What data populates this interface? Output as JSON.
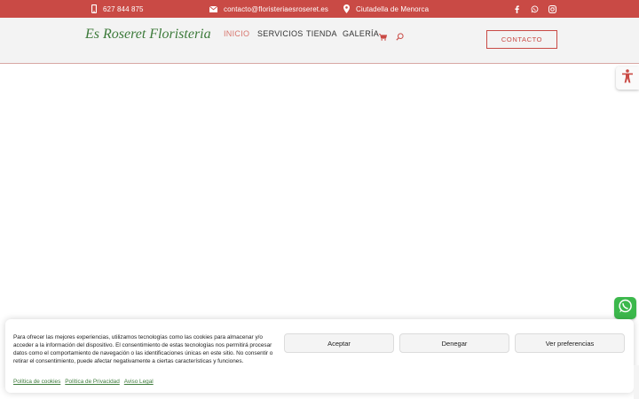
{
  "topbar": {
    "phone": "627 844 875",
    "email": "contacto@floristeriaesroseret.es",
    "location": "Ciutadella de Menorca",
    "social": [
      "facebook-icon",
      "whatsapp-icon",
      "instagram-icon"
    ]
  },
  "header": {
    "logo": "Es Roseret Floristeria",
    "nav": [
      "INICIO",
      "SERVICIOS",
      "TIENDA",
      "GALERÍA"
    ],
    "contact_button": "CONTACTO"
  },
  "cookie_banner": {
    "text": "Para ofrecer las mejores experiencias, utilizamos tecnologías como las cookies para almacenar y/o acceder a la información del dispositivo. El consentimiento de estas tecnologías nos permitirá procesar datos como el comportamiento de navegación o las identificaciones únicas en este sitio. No consentir o retirar el consentimiento, puede afectar negativamente a ciertas características y funciones.",
    "accept": "Aceptar",
    "deny": "Denegar",
    "preferences": "Ver preferencias",
    "links": [
      "Política de cookies",
      "Política de Privacidad",
      "Aviso Legal"
    ]
  },
  "colors": {
    "topbar": "#c94a45",
    "brand_green": "#3c7a3a",
    "nav_active": "#d8746c",
    "whatsapp": "#3cb84c"
  }
}
